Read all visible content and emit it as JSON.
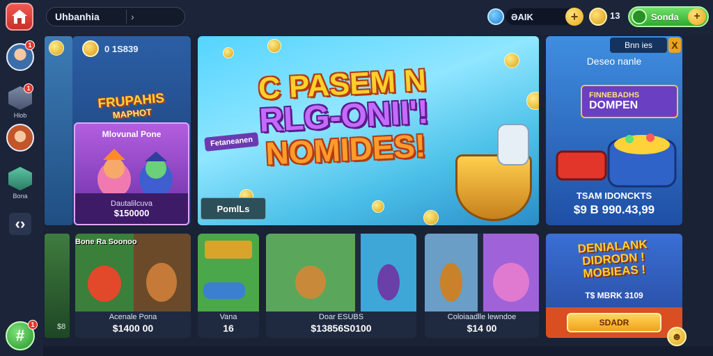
{
  "header": {
    "breadcrumb": "Uhbanhia",
    "gems": "ƏAIK",
    "coins": "13",
    "green_button": "Sonda"
  },
  "sidebar": {
    "items": [
      {
        "label": "",
        "badge": "1"
      },
      {
        "label": "Hlob",
        "badge": "1"
      },
      {
        "label": "",
        "badge": ""
      },
      {
        "label": "Bona",
        "badge": ""
      }
    ],
    "fab_badge": "1"
  },
  "panel_a": {
    "top_value": "0 1S839",
    "logo_line1": "FRUPAHIS",
    "logo_line2": "MAPHOT",
    "promo_title": "Mlovunal Pone",
    "promo_sub": "Dautalilcuva",
    "promo_price": "$150000"
  },
  "hero": {
    "line1": "C PASEM N",
    "line2": "RLG-ONII'!",
    "line3": "NOMIDES!",
    "tag": "Fetaneanen",
    "button": "PomlLs"
  },
  "panel_c": {
    "head": "Bnn ies",
    "close": "X",
    "subtitle": "Deseo nanle",
    "board_a": "FINNEBADHS",
    "board_b": "DOMPEN",
    "foot1": "TSAM IDONCKTS",
    "foot2": "$9 B 990.43,99"
  },
  "bottom": {
    "strip_value": "$8",
    "label": "Bone Ra Soonoo",
    "cards": [
      {
        "t1": "Acenale Pona",
        "t2": "$1400 00"
      },
      {
        "t1": "Vana",
        "t2": "16"
      },
      {
        "t1": "Doar ESUBS",
        "t2": "$13856S0100"
      },
      {
        "t1": "Coloiaadlle lewndoe",
        "t2": "$14 00"
      }
    ]
  },
  "panel_f": {
    "title_1": "DENIALANK",
    "title_2": "DIDRODN !",
    "title_3": "MOBIEAS !",
    "row": "T$ MBRK   3109",
    "button": "SDADR"
  },
  "colors": {
    "home": "#e6332a",
    "accent_green": "#2fa92c",
    "gold": "#ffd02b",
    "purple": "#8a42c8"
  }
}
